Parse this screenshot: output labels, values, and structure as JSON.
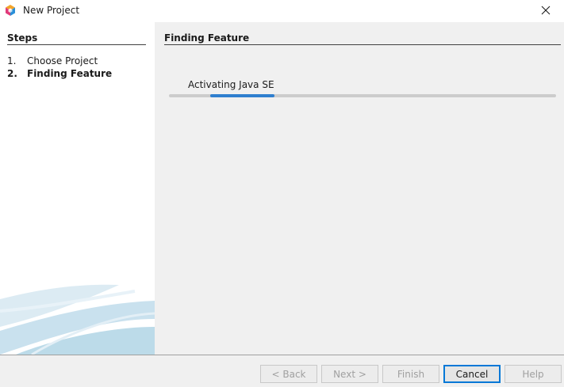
{
  "window": {
    "title": "New Project",
    "icon": "netbeans-cube-icon"
  },
  "steps": {
    "heading": "Steps",
    "items": [
      {
        "number": "1.",
        "label": "Choose Project",
        "current": false
      },
      {
        "number": "2.",
        "label": "Finding Feature",
        "current": true
      }
    ]
  },
  "main": {
    "heading": "Finding Feature",
    "progress_label": "Activating Java SE",
    "progress_style": "indeterminate"
  },
  "buttons": {
    "back": "< Back",
    "next": "Next >",
    "finish": "Finish",
    "cancel": "Cancel",
    "help": "Help"
  },
  "colors": {
    "accent": "#2f7fcf",
    "default_button_border": "#0078d7"
  }
}
